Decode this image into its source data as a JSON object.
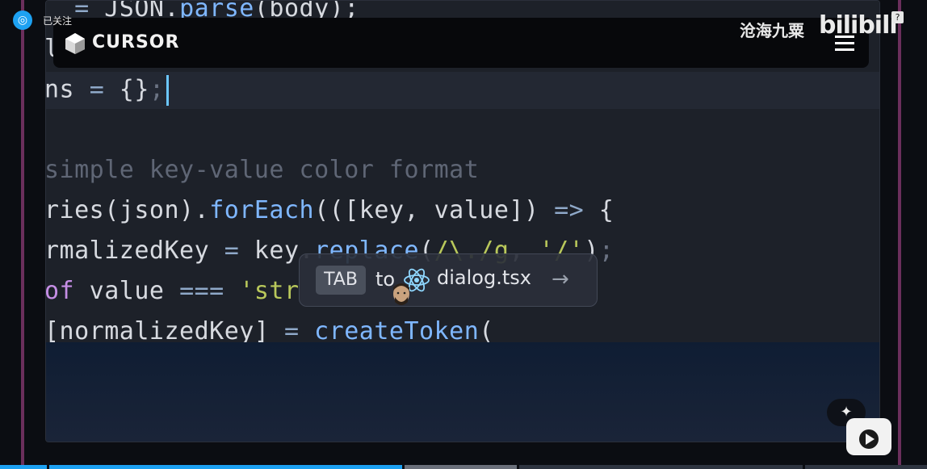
{
  "follow": {
    "status_label": "已关注"
  },
  "brand": {
    "name": "CURSOR"
  },
  "uploader": {
    "name": "沧海九粟"
  },
  "platform": {
    "logo_text": "bilibili"
  },
  "help": {
    "label": "?"
  },
  "code": {
    "lines": [
      "= JSON.parse(body);",
      "l",
      "ns = {};",
      "simple key-value color format",
      "ries(json).forEach(([key, value]) => {",
      "rmalizedKey = key.replace(/\\./g, '/');",
      "of value === 'str",
      "[normalizedKey] = createToken("
    ]
  },
  "tab_suggestion": {
    "key_label": "TAB",
    "to_label": "to",
    "file_name": "dialog.tsx",
    "arrow": "→"
  },
  "controls": {
    "magic_icon": "✦"
  },
  "progress": {
    "played_fraction": 0.435,
    "buffered_fraction": 0.56
  },
  "colors": {
    "accent": "#1da1f2",
    "frame": "#6b2f5c",
    "caret": "#6bc6ff"
  }
}
